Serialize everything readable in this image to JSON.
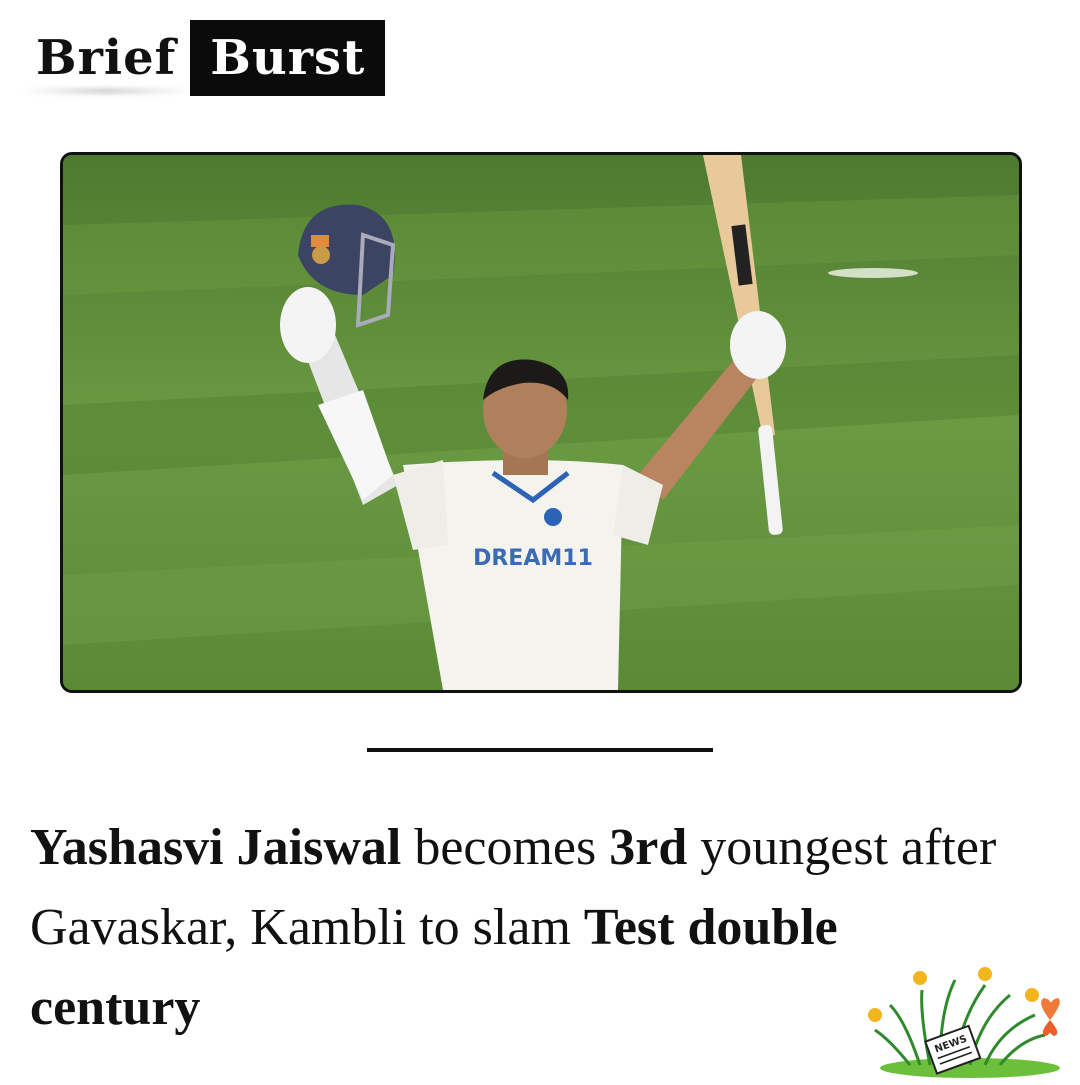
{
  "brand": {
    "part1": "Brief",
    "part2": "Burst"
  },
  "photo": {
    "jersey_text": "DREAM11",
    "colors": {
      "grass": "#5e8c3b",
      "grass_dark": "#4f7a30",
      "jersey": "#f4f3ee",
      "helmet": "#3b4462"
    }
  },
  "headline": {
    "s1": "Yashasvi Jaiswal",
    "s2": " becomes ",
    "s3": "3rd",
    "s4": " youngest after Gavaskar, Kambli to slam ",
    "s5": "Test double century"
  },
  "decoration": {
    "sign_text": "NEWS",
    "icon": "grass-flowers-butterfly-icon"
  }
}
